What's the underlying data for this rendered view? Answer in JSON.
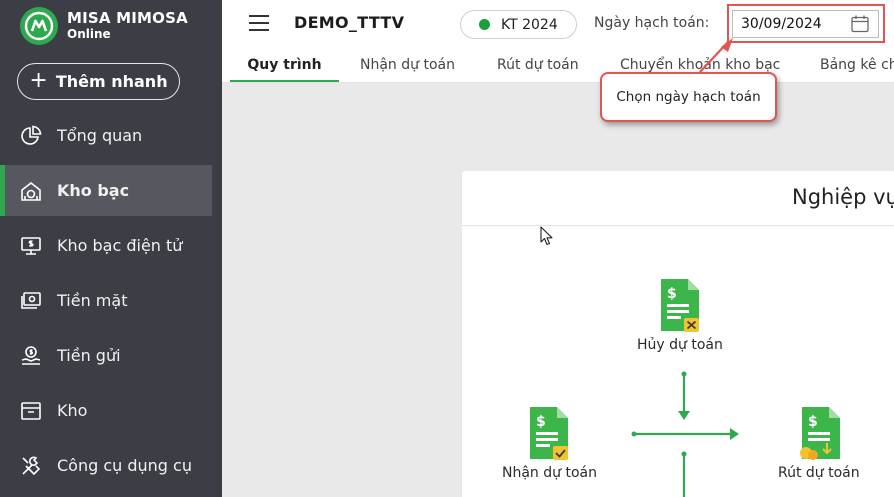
{
  "app": {
    "brand_name": "MISA MIMOSA",
    "brand_sub": "Online",
    "quick_add_label": "Thêm nhanh"
  },
  "sidebar": {
    "items": [
      {
        "label": "Tổng quan",
        "icon": "pie-chart-icon",
        "active": false
      },
      {
        "label": "Kho bạc",
        "icon": "treasury-icon",
        "active": true
      },
      {
        "label": "Kho bạc điện tử",
        "icon": "monitor-money-icon",
        "active": false
      },
      {
        "label": "Tiền mặt",
        "icon": "cash-icon",
        "active": false
      },
      {
        "label": "Tiền gửi",
        "icon": "deposit-icon",
        "active": false
      },
      {
        "label": "Kho",
        "icon": "warehouse-icon",
        "active": false
      },
      {
        "label": "Công cụ dụng cụ",
        "icon": "tools-icon",
        "active": false
      }
    ]
  },
  "header": {
    "company": "DEMO_TTTV",
    "fiscal_year": "KT 2024",
    "fiscal_status_color": "#19a03a",
    "date_label": "Ngày hạch toán:",
    "date_value": "30/09/2024"
  },
  "tabs": [
    {
      "label": "Quy trình",
      "active": true
    },
    {
      "label": "Nhận dự toán",
      "active": false
    },
    {
      "label": "Rút dự toán",
      "active": false
    },
    {
      "label": "Chuyển khoản kho bạc",
      "active": false
    },
    {
      "label": "Bảng kê chứng từ",
      "active": false
    }
  ],
  "tooltip": {
    "text": "Chọn ngày hạch toán"
  },
  "workflow": {
    "title": "Nghiệp vụ",
    "nodes": [
      {
        "label": "Hủy dự toán",
        "icon": "document-cancel-icon"
      },
      {
        "label": "Nhận dự toán",
        "icon": "document-check-icon"
      },
      {
        "label": "Rút dự toán",
        "icon": "document-withdraw-icon"
      }
    ]
  },
  "colors": {
    "accent": "#2fa84f",
    "sidebar_bg": "#3b3f45",
    "highlight": "#e05550"
  }
}
